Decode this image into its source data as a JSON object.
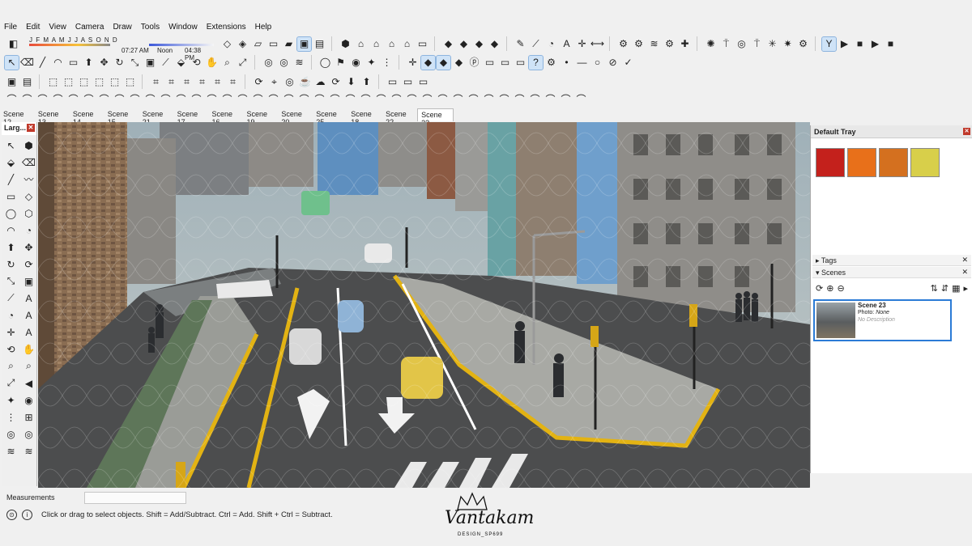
{
  "app": {
    "menu": [
      "File",
      "Edit",
      "View",
      "Camera",
      "Draw",
      "Tools",
      "Window",
      "Extensions",
      "Help"
    ]
  },
  "shadows": {
    "months": "J F M A M J J A S O N D",
    "time_left": "07:27 AM",
    "time_mid": "Noon",
    "time_right": "04:38 PM"
  },
  "scene_tabs": [
    "Scene 12",
    "Scene 13",
    "Scene 14",
    "Scene 15",
    "Scene 21",
    "Scene 17",
    "Scene 16",
    "Scene 19",
    "Scene 20",
    "Scene 25",
    "Scene 18",
    "Scene 22",
    "Scene 23"
  ],
  "active_scene_tab": "Scene 23",
  "left_tray": {
    "title": "Larg..."
  },
  "default_tray": {
    "title": "Default Tray",
    "tags_label": "Tags",
    "scenes_label": "Scenes",
    "swatch_colors": [
      "#c4211c",
      "#e8701a",
      "#d4701f",
      "#d8cf4a"
    ],
    "scene": {
      "name": "Scene 23",
      "photo_label": "Photo:",
      "photo_value": "None",
      "description": "No Description"
    }
  },
  "measurements": {
    "label": "Measurements",
    "value": ""
  },
  "status": {
    "message": "Click or drag to select objects. Shift = Add/Subtract. Ctrl = Add. Shift + Ctrl = Subtract."
  },
  "watermark": {
    "text": "Vantakam",
    "subtext": "DESIGN_SP699"
  }
}
